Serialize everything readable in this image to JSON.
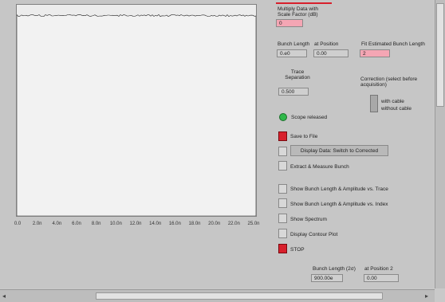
{
  "plot": {
    "x_ticks": [
      "0.0",
      "2.0n",
      "4.0n",
      "6.0n",
      "8.0n",
      "10.0n",
      "12.0n",
      "14.0n",
      "16.0n",
      "18.0n",
      "20.0n",
      "22.0n",
      "25.0n"
    ]
  },
  "controls": {
    "multiply_label": "Multiply Data with Scale Factor (dB)",
    "multiply_value": "0",
    "bunch_length_label": "Bunch Length",
    "at_position_label": "at Position",
    "bunch_length_value": "0.e0",
    "at_position_value": "0.00",
    "fit_label": "Fit Estimated Bunch Length",
    "fit_value": "2",
    "trace_sep_label": "Trace Separation",
    "trace_sep_value": "0.500",
    "correction_label": "Correction (select before acquisition)",
    "with_cable": "with cable",
    "without_cable": "without cable",
    "scope_label": "Scope released",
    "save_label": "Save to File",
    "display_data_label": "Display Data: Switch to Corrected",
    "extract_label": "Extract & Measure Bunch",
    "show_trace_label": "Show Bunch Length & Amplitude vs. Trace",
    "show_index_label": "Show Bunch Length & Amplitude vs. Index",
    "spectrum_label": "Show Spectrum",
    "contour_label": "Display Contour Plot",
    "stop_label": "STOP",
    "bunch2_label": "Bunch Length (2σ)",
    "position2_label": "at Position 2",
    "bunch2_value": "900.00e",
    "position2_value": "0.00"
  },
  "colors": {
    "accent_red": "#d8202c",
    "field_pink": "#f4a6b4",
    "led_green": "#2fb84a"
  }
}
